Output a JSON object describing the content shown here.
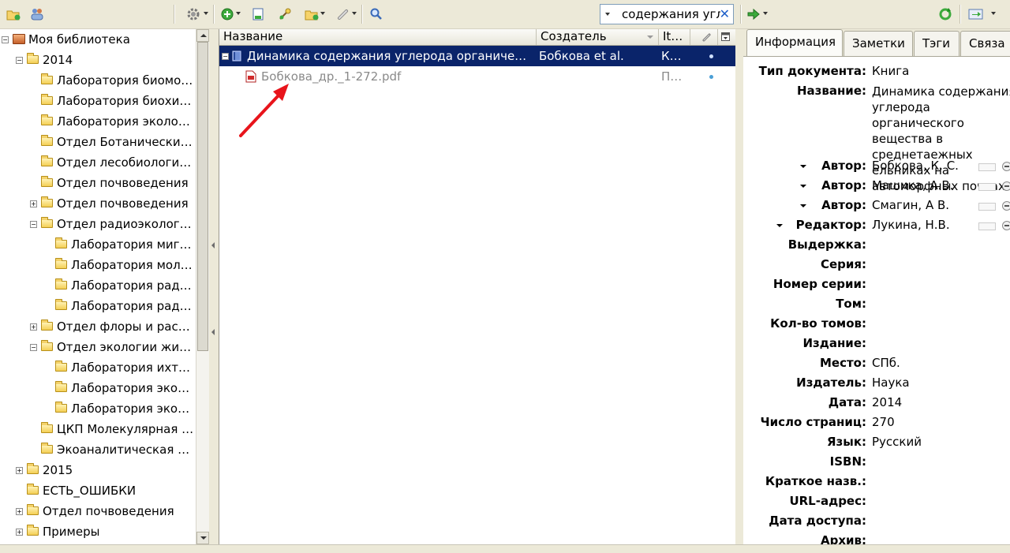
{
  "toolbar": {
    "search_value": "содержания угл",
    "icons": [
      "new-collection-icon",
      "new-group-icon",
      "actions-gear-icon",
      "new-item-icon",
      "new-note-icon",
      "add-by-identifier-icon",
      "add-attachment-icon",
      "attach-link-icon",
      "advanced-search-icon",
      "locate-arrow-icon",
      "sync-icon",
      "fullscreen-icon"
    ]
  },
  "tree": {
    "root_label": "Моя библиотека",
    "items": [
      {
        "label": "2014",
        "level": 1,
        "expander": "minus"
      },
      {
        "label": "Лаборатория биомо…",
        "level": 2,
        "expander": ""
      },
      {
        "label": "Лаборатория биохим…",
        "level": 2,
        "expander": ""
      },
      {
        "label": "Лаборатория эколог…",
        "level": 2,
        "expander": ""
      },
      {
        "label": "Отдел Ботанически…",
        "level": 2,
        "expander": ""
      },
      {
        "label": "Отдел лесобиологи…",
        "level": 2,
        "expander": ""
      },
      {
        "label": "Отдел почвоведения",
        "level": 2,
        "expander": ""
      },
      {
        "label": "Отдел почвоведения",
        "level": 2,
        "expander": "plus"
      },
      {
        "label": "Отдел радиоэкологии",
        "level": 2,
        "expander": "minus"
      },
      {
        "label": "Лаборатория мигр…",
        "level": 3,
        "expander": ""
      },
      {
        "label": "Лаборатория мол…",
        "level": 3,
        "expander": ""
      },
      {
        "label": "Лаборатория рад…",
        "level": 3,
        "expander": ""
      },
      {
        "label": "Лаборатория рад…",
        "level": 3,
        "expander": ""
      },
      {
        "label": "Отдел флоры и рас…",
        "level": 2,
        "expander": "plus"
      },
      {
        "label": "Отдел экологии жив…",
        "level": 2,
        "expander": "minus"
      },
      {
        "label": "Лаборатория ихти…",
        "level": 3,
        "expander": ""
      },
      {
        "label": "Лаборатория экол…",
        "level": 3,
        "expander": ""
      },
      {
        "label": "Лаборатория экол…",
        "level": 3,
        "expander": ""
      },
      {
        "label": "ЦКП Молекулярная …",
        "level": 2,
        "expander": ""
      },
      {
        "label": "Экоаналитическая л…",
        "level": 2,
        "expander": ""
      },
      {
        "label": "2015",
        "level": 1,
        "expander": "plus"
      },
      {
        "label": "ЕСТЬ_ОШИБКИ",
        "level": 1,
        "expander": ""
      },
      {
        "label": "Отдел почвоведения",
        "level": 1,
        "expander": "plus"
      },
      {
        "label": "Примеры",
        "level": 1,
        "expander": "plus"
      }
    ]
  },
  "items_table": {
    "columns": {
      "title": "Название",
      "creator": "Создатель",
      "type": "It…"
    },
    "rows": [
      {
        "title": "Динамика содержания углерода органическ…",
        "creator": "Бобкова et al.",
        "type": "К…",
        "selected": true,
        "kind": "book"
      },
      {
        "title": "Бобкова_др._1-272.pdf",
        "creator": "",
        "type": "П…",
        "selected": false,
        "kind": "pdf"
      }
    ]
  },
  "tabs": [
    "Информация",
    "Заметки",
    "Тэги",
    "Связа"
  ],
  "info": {
    "doc_type_label": "Тип документа:",
    "doc_type": "Книга",
    "title_label": "Название:",
    "title": "Динамика содержания углерода органического вещества в среднетаежных ельниках на автоморфных почвах",
    "creators": [
      {
        "role": "Автор:",
        "name": "Бобкова, К. С."
      },
      {
        "role": "Автор:",
        "name": "Машика, А.В."
      },
      {
        "role": "Автор:",
        "name": "Смагин, А В."
      },
      {
        "role": "Редактор:",
        "name": "Лукина, Н.В."
      }
    ],
    "fields": [
      {
        "label": "Выдержка:",
        "value": ""
      },
      {
        "label": "Серия:",
        "value": ""
      },
      {
        "label": "Номер серии:",
        "value": ""
      },
      {
        "label": "Том:",
        "value": ""
      },
      {
        "label": "Кол-во томов:",
        "value": ""
      },
      {
        "label": "Издание:",
        "value": ""
      },
      {
        "label": "Место:",
        "value": "СПб."
      },
      {
        "label": "Издатель:",
        "value": "Наука"
      },
      {
        "label": "Дата:",
        "value": "2014"
      },
      {
        "label": "Число страниц:",
        "value": "270"
      },
      {
        "label": "Язык:",
        "value": "Русский"
      },
      {
        "label": "ISBN:",
        "value": ""
      },
      {
        "label": "Краткое назв.:",
        "value": ""
      },
      {
        "label": "URL-адрес:",
        "value": ""
      },
      {
        "label": "Дата доступа:",
        "value": ""
      },
      {
        "label": "Архив:",
        "value": ""
      }
    ]
  },
  "colors": {
    "selection": "#0a246a",
    "annotation_arrow": "#e8141b",
    "chrome": "#ece9d8"
  }
}
